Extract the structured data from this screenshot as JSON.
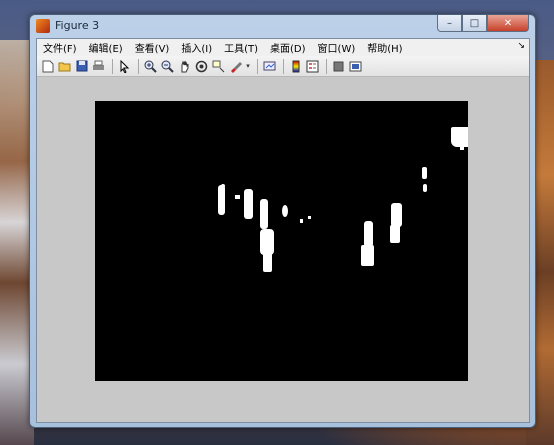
{
  "window": {
    "title": "Figure 3",
    "buttons": {
      "minimize": "–",
      "maximize": "□",
      "close": "✕"
    }
  },
  "menubar": {
    "items": [
      "文件(F)",
      "编辑(E)",
      "查看(V)",
      "插入(I)",
      "工具(T)",
      "桌面(D)",
      "窗口(W)",
      "帮助(H)"
    ],
    "overflow": "↘"
  },
  "toolbar": {
    "icons": [
      "new-figure-icon",
      "open-file-icon",
      "save-icon",
      "print-icon",
      "pointer-icon",
      "zoom-in-icon",
      "zoom-out-icon",
      "pan-icon",
      "rotate-3d-icon",
      "data-cursor-icon",
      "brush-icon",
      "link-plot-icon",
      "colorbar-icon",
      "legend-icon",
      "hide-plot-tools-icon",
      "show-plot-tools-icon"
    ]
  },
  "figure": {
    "background_color": "#000000",
    "foreground_color": "#ffffff",
    "description_kind": "binary foreground mask"
  }
}
